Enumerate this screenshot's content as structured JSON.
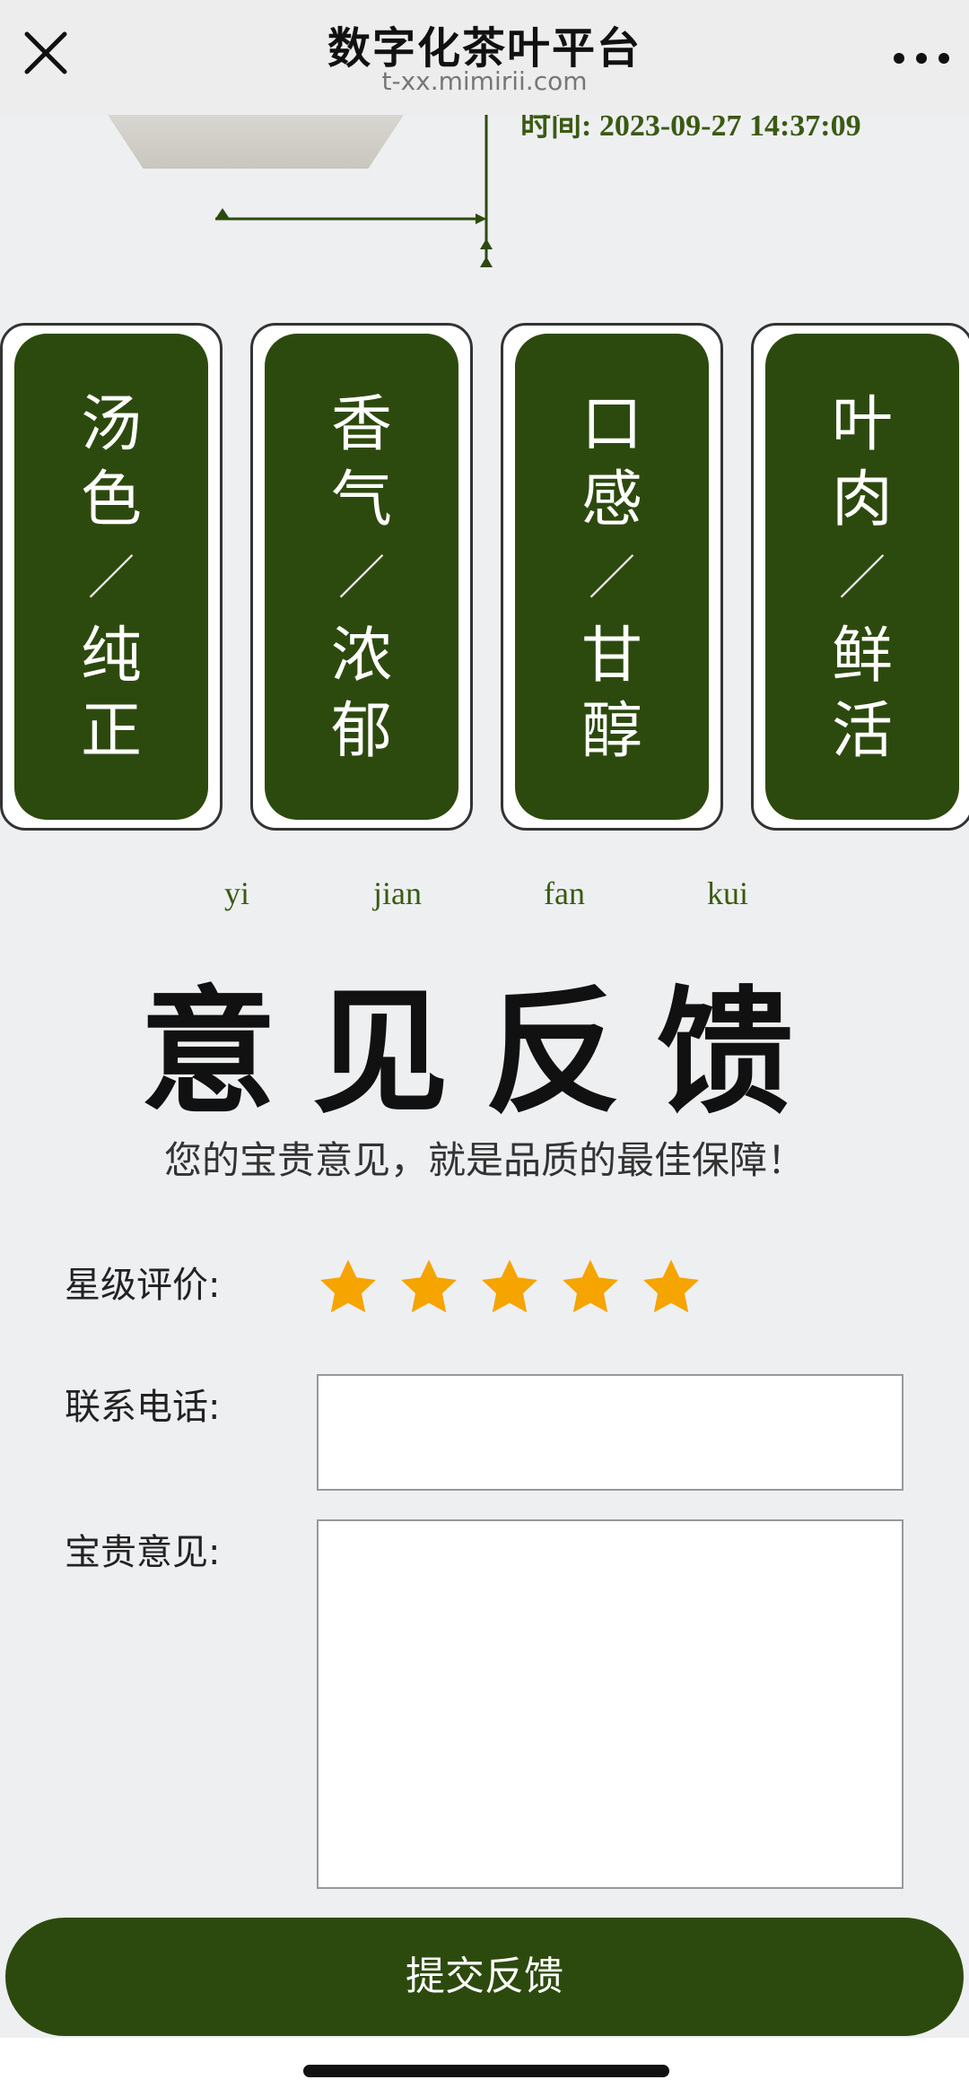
{
  "topbar": {
    "title": "数字化茶叶平台",
    "subtitle": "t-xx.mimirii.com",
    "close_icon": "close-icon",
    "more_icon": "more-icon"
  },
  "header_partial": {
    "time_text": "时间: 2023-09-27 14:37:09"
  },
  "cards": [
    {
      "line1": "汤",
      "line2": "色",
      "slash": "／",
      "line3": "纯",
      "line4": "正"
    },
    {
      "line1": "香",
      "line2": "气",
      "slash": "／",
      "line3": "浓",
      "line4": "郁"
    },
    {
      "line1": "口",
      "line2": "感",
      "slash": "／",
      "line3": "甘",
      "line4": "醇"
    },
    {
      "line1": "叶",
      "line2": "肉",
      "slash": "／",
      "line3": "鲜",
      "line4": "活"
    }
  ],
  "feedback": {
    "pinyin": [
      "yi",
      "jian",
      "fan",
      "kui"
    ],
    "title": "意见反馈",
    "slogan": "您的宝贵意见，就是品质的最佳保障！"
  },
  "form": {
    "rating_label": "星级评价:",
    "rating_value": 5,
    "rating_max": 5,
    "phone_label": "联系电话:",
    "phone_value": "",
    "opinion_label": "宝贵意见:",
    "opinion_value": "",
    "submit_label": "提交反馈"
  },
  "colors": {
    "brand_green": "#2d4a0e",
    "accent_text_green": "#3a5a12",
    "star": "#f5a400",
    "background": "#eeeff1"
  }
}
